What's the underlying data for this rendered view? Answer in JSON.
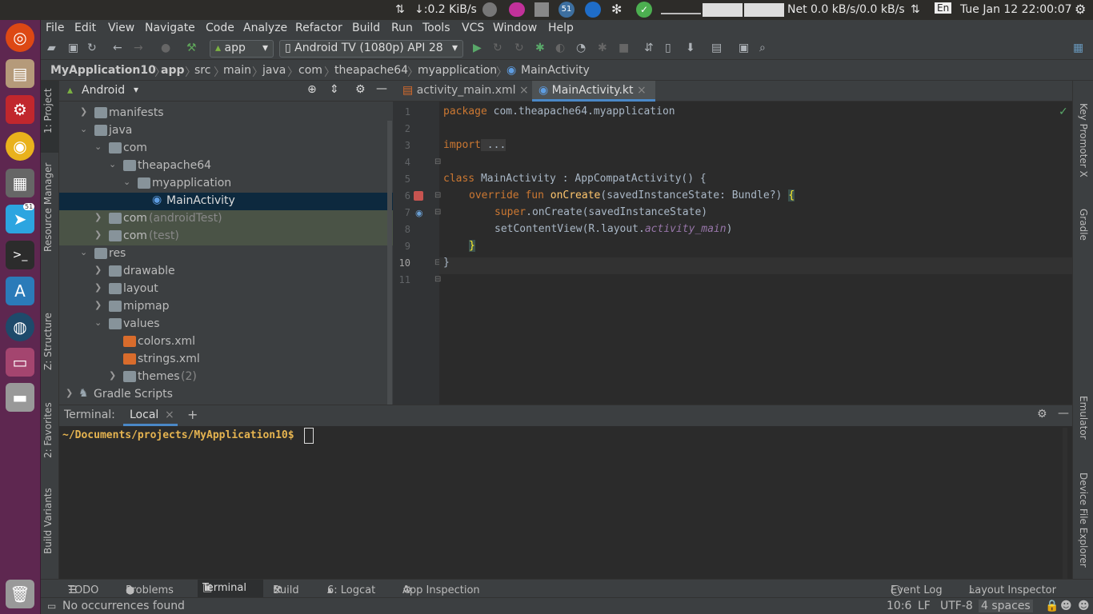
{
  "panel": {
    "net_down": "↓:0.2 KiB/s",
    "badge_count": "51",
    "net_rate": "Net 0.0 kB/s/0.0 kB/s",
    "keyboard": "En",
    "clock": "Tue Jan 12 22:00:07"
  },
  "launcher": {
    "telegram_badge": "51"
  },
  "menu": [
    "File",
    "Edit",
    "View",
    "Navigate",
    "Code",
    "Analyze",
    "Refactor",
    "Build",
    "Run",
    "Tools",
    "VCS",
    "Window",
    "Help"
  ],
  "toolbar": {
    "run_config": "app",
    "device": "Android TV (1080p) API 28"
  },
  "breadcrumb": [
    "MyApplication10",
    "app",
    "src",
    "main",
    "java",
    "com",
    "theapache64",
    "myapplication",
    "MainActivity"
  ],
  "left_tools": {
    "project": "1: Project",
    "resource_manager": "Resource Manager",
    "structure": "Z: Structure",
    "favorites": "2: Favorites",
    "build_variants": "Build Variants"
  },
  "right_tools": {
    "key_promoter": "Key Promoter X",
    "gradle": "Gradle",
    "emulator": "Emulator",
    "device_file_explorer": "Device File Explorer"
  },
  "project_panel": {
    "view_mode": "Android",
    "tree": [
      {
        "label": "manifests",
        "extra": ""
      },
      {
        "label": "java",
        "extra": ""
      },
      {
        "label": "com",
        "extra": ""
      },
      {
        "label": "theapache64",
        "extra": ""
      },
      {
        "label": "myapplication",
        "extra": ""
      },
      {
        "label": "MainActivity",
        "extra": ""
      },
      {
        "label": "com",
        "extra": "(androidTest)"
      },
      {
        "label": "com",
        "extra": "(test)"
      },
      {
        "label": "res",
        "extra": ""
      },
      {
        "label": "drawable",
        "extra": ""
      },
      {
        "label": "layout",
        "extra": ""
      },
      {
        "label": "mipmap",
        "extra": ""
      },
      {
        "label": "values",
        "extra": ""
      },
      {
        "label": "colors.xml",
        "extra": ""
      },
      {
        "label": "strings.xml",
        "extra": ""
      },
      {
        "label": "themes",
        "extra": "(2)"
      },
      {
        "label": "Gradle Scripts",
        "extra": ""
      }
    ]
  },
  "editor": {
    "tabs": [
      {
        "label": "activity_main.xml",
        "close": "×"
      },
      {
        "label": "MainActivity.kt",
        "close": "×"
      }
    ],
    "line_numbers": [
      "1",
      "2",
      "3",
      "4",
      "5",
      "6",
      "7",
      "8",
      "9",
      "10",
      "11"
    ],
    "code": {
      "l1_kw": "package",
      "l1_rest": " com.theapache64.myapplication",
      "l3_kw": "import",
      "l3_rest": " ...",
      "l6_kw": "class",
      "l6_rest": " MainActivity : AppCompatActivity() {",
      "l7_kw": "override fun",
      "l7_fn": " onCreate",
      "l7_rest": "(savedInstanceState: Bundle?) ",
      "l7_brace": "{",
      "l8_kw": "super",
      "l8_rest": ".onCreate(savedInstanceState)",
      "l9_a": "setContentView(R.layout.",
      "l9_b": "activity_main",
      "l9_c": ")",
      "l10": "}",
      "l11": "}"
    }
  },
  "terminal": {
    "label": "Terminal:",
    "tab": "Local",
    "close": "×",
    "add": "+",
    "prompt": "~/Documents/projects/MyApplication10$"
  },
  "bottom_tools": [
    "TODO",
    "Problems",
    "Terminal",
    "Build",
    "6: Logcat",
    "App Inspection"
  ],
  "bottom_right": [
    "Event Log",
    "Layout Inspector"
  ],
  "status": {
    "message": "No occurrences found",
    "position": "10:6",
    "line_sep": "LF",
    "encoding": "UTF-8",
    "indent": "4 spaces"
  }
}
